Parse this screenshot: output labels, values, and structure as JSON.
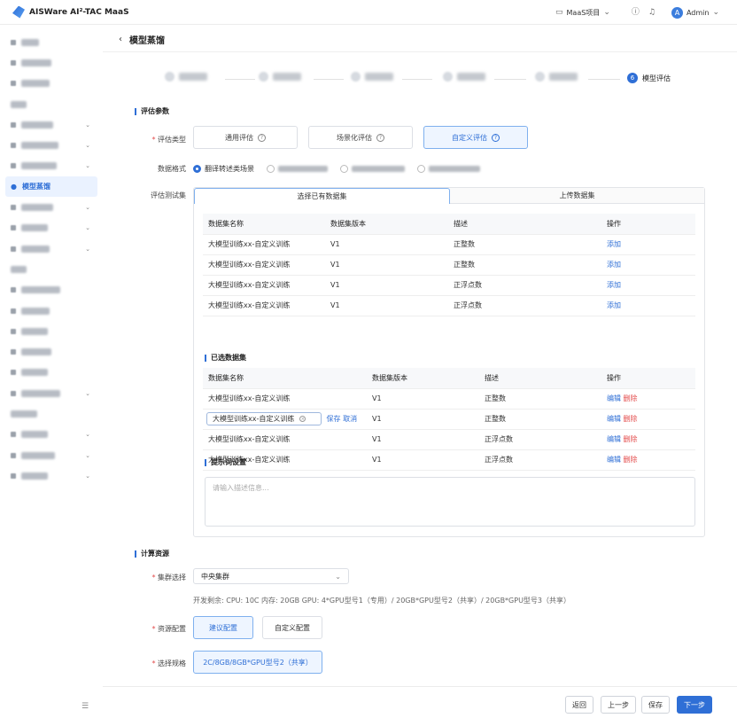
{
  "app": {
    "title": "AISWare AI²-TAC MaaS",
    "project": "MaaS项目",
    "user": "Admin",
    "avatar_initial": "A"
  },
  "sidebar": {
    "active_label": "模型蒸馏"
  },
  "page": {
    "title": "模型蒸馏",
    "current_step_number": "6",
    "current_step_label": "模型评估"
  },
  "eval": {
    "section_title": "评估参数",
    "type_label": "评估类型",
    "type_options": [
      "通用评估",
      "场景化评估",
      "自定义评估"
    ],
    "format_label": "数据格式",
    "format_selected": "翻译转述类场景",
    "testset_label": "评估测试集",
    "tabs": [
      "选择已有数据集",
      "上传数据集"
    ],
    "table_headers": [
      "数据集名称",
      "数据集版本",
      "描述",
      "操作"
    ],
    "rows": [
      {
        "name": "大模型训练xx-自定义训练",
        "version": "V1",
        "desc": "正整数",
        "action": "添加"
      },
      {
        "name": "大模型训练xx-自定义训练",
        "version": "V1",
        "desc": "正整数",
        "action": "添加"
      },
      {
        "name": "大模型训练xx-自定义训练",
        "version": "V1",
        "desc": "正浮点数",
        "action": "添加"
      },
      {
        "name": "大模型训练xx-自定义训练",
        "version": "V1",
        "desc": "正浮点数",
        "action": "添加"
      }
    ],
    "selected_title": "已选数据集",
    "selected_headers": [
      "数据集名称",
      "数据集版本",
      "描述",
      "操作"
    ],
    "selected_rows": [
      {
        "name": "大模型训练xx-自定义训练",
        "version": "V1",
        "desc": "正整数"
      },
      {
        "name": "大模型训练xx-自定义训练",
        "version": "V1",
        "desc": "正整数"
      },
      {
        "name": "大模型训练xx-自定义训练",
        "version": "V1",
        "desc": "正浮点数"
      },
      {
        "name": "大模型训练xx-自定义训练",
        "version": "V1",
        "desc": "正浮点数"
      }
    ],
    "edit_value": "大模型训练xx-自定义训练",
    "save": "保存",
    "cancel": "取消",
    "edit": "编辑",
    "delete": "删除",
    "prompt_title": "提示词设置",
    "prompt_placeholder": "请输入描述信息..."
  },
  "compute": {
    "section_title": "计算资源",
    "cluster_label": "集群选择",
    "cluster_value": "中央集群",
    "remaining": "开发剩余:  CPU:  10C      内存:  20GB      GPU:  4*GPU型号1（专用）/ 20GB*GPU型号2（共享）/ 20GB*GPU型号3（共享）",
    "resource_label": "资源配置",
    "resource_options": [
      "建议配置",
      "自定义配置"
    ],
    "spec_label": "选择规格",
    "spec_value": "2C/8GB/8GB*GPU型号2（共享）"
  },
  "footer": {
    "back": "返回",
    "prev": "上一步",
    "save": "保存",
    "next": "下一步"
  }
}
